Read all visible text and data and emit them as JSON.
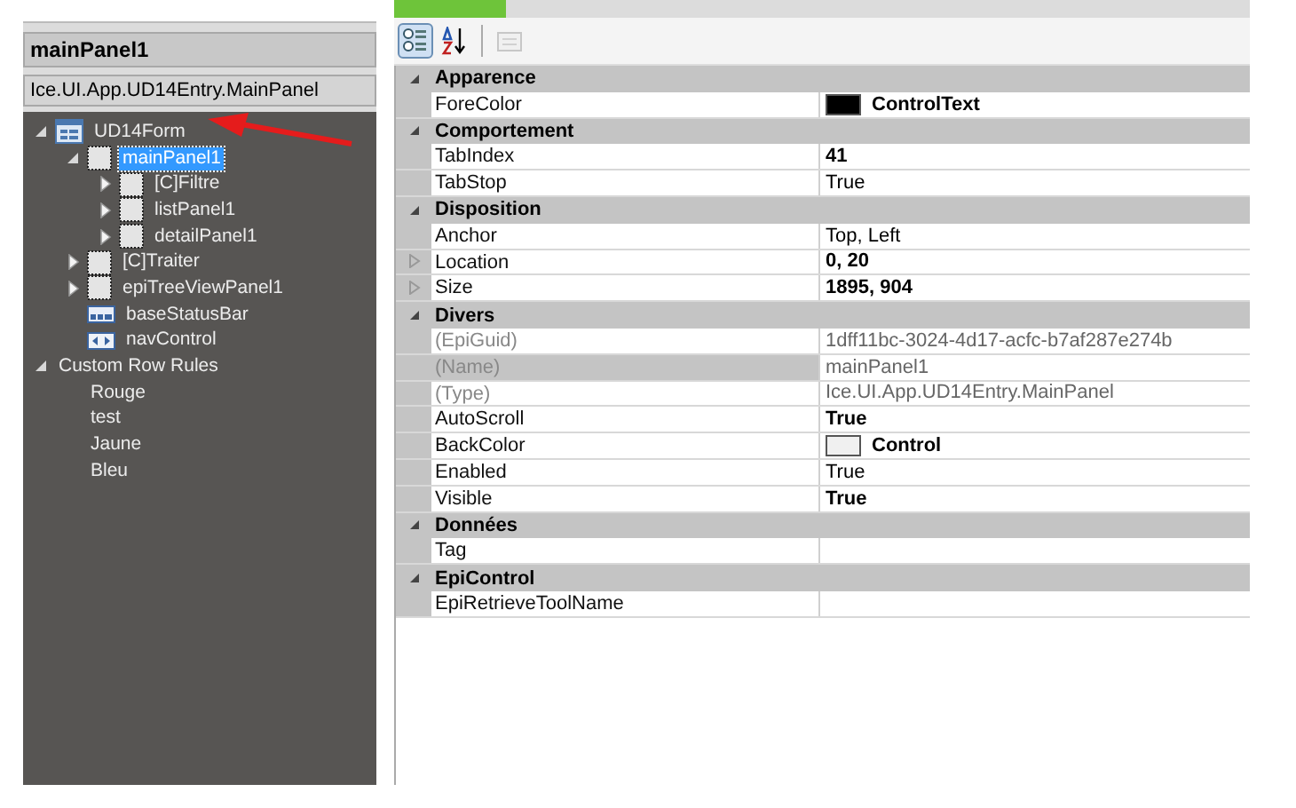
{
  "object_panel": {
    "title": "mainPanel1",
    "type": "Ice.UI.App.UD14Entry.MainPanel"
  },
  "tree": [
    {
      "label": "UD14Form",
      "kind": "form",
      "expanded": true,
      "selected": false,
      "children": [
        {
          "label": "mainPanel1",
          "kind": "panel",
          "expanded": true,
          "selected": true,
          "children": [
            {
              "label": "[C]Filtre",
              "kind": "panel",
              "expanded": false,
              "selected": false
            },
            {
              "label": "listPanel1",
              "kind": "panel",
              "expanded": false,
              "selected": false
            },
            {
              "label": "detailPanel1",
              "kind": "panel",
              "expanded": false,
              "selected": false
            }
          ]
        },
        {
          "label": "[C]Traiter",
          "kind": "panel",
          "expanded": false,
          "selected": false
        },
        {
          "label": "epiTreeViewPanel1",
          "kind": "panel",
          "expanded": false,
          "selected": false
        },
        {
          "label": "baseStatusBar",
          "kind": "statusbar",
          "selected": false
        },
        {
          "label": "navControl",
          "kind": "nav",
          "selected": false
        }
      ]
    },
    {
      "label": "Custom Row Rules",
      "expanded": true,
      "selected": false,
      "children": [
        {
          "label": "Rouge",
          "selected": false
        },
        {
          "label": "test",
          "selected": false
        },
        {
          "label": "Jaune",
          "selected": false
        },
        {
          "label": "Bleu",
          "selected": false
        }
      ]
    }
  ],
  "toolbar": [
    {
      "kind": "categorized",
      "selected": true
    },
    {
      "kind": "alphabetical",
      "selected": false
    },
    {
      "kind": "pages",
      "selected": false,
      "disabled": true
    }
  ],
  "properties": [
    {
      "category": "Apparence",
      "rows": [
        {
          "name": "ForeColor",
          "value": "ControlText",
          "bold": true,
          "color": "#000000"
        }
      ]
    },
    {
      "category": "Comportement",
      "rows": [
        {
          "name": "TabIndex",
          "value": "41",
          "bold": true
        },
        {
          "name": "TabStop",
          "value": "True",
          "bold": false
        }
      ]
    },
    {
      "category": "Disposition",
      "rows": [
        {
          "name": "Anchor",
          "value": "Top, Left",
          "bold": false
        },
        {
          "name": "Location",
          "value": "0, 20",
          "bold": true,
          "expandable": true
        },
        {
          "name": "Size",
          "value": "1895, 904",
          "bold": true,
          "expandable": true
        }
      ]
    },
    {
      "category": "Divers",
      "rows": [
        {
          "name": "(EpiGuid)",
          "value": "1dff11bc-3024-4d17-acfc-b7af287e274b",
          "bold": false,
          "readonly": true
        },
        {
          "name": "(Name)",
          "value": "mainPanel1",
          "bold": false,
          "readonly": true,
          "selected": true
        },
        {
          "name": "(Type)",
          "value": "Ice.UI.App.UD14Entry.MainPanel",
          "bold": false,
          "readonly": true
        },
        {
          "name": "AutoScroll",
          "value": "True",
          "bold": true
        },
        {
          "name": "BackColor",
          "value": "Control",
          "bold": true,
          "color": "#f0f0f0"
        },
        {
          "name": "Enabled",
          "value": "True",
          "bold": false
        },
        {
          "name": "Visible",
          "value": "True",
          "bold": true
        }
      ]
    },
    {
      "category": "Données",
      "rows": [
        {
          "name": "Tag"
        }
      ]
    },
    {
      "category": "EpiControl",
      "rows": [
        {
          "name": "EpiRetrieveToolName"
        }
      ]
    }
  ]
}
